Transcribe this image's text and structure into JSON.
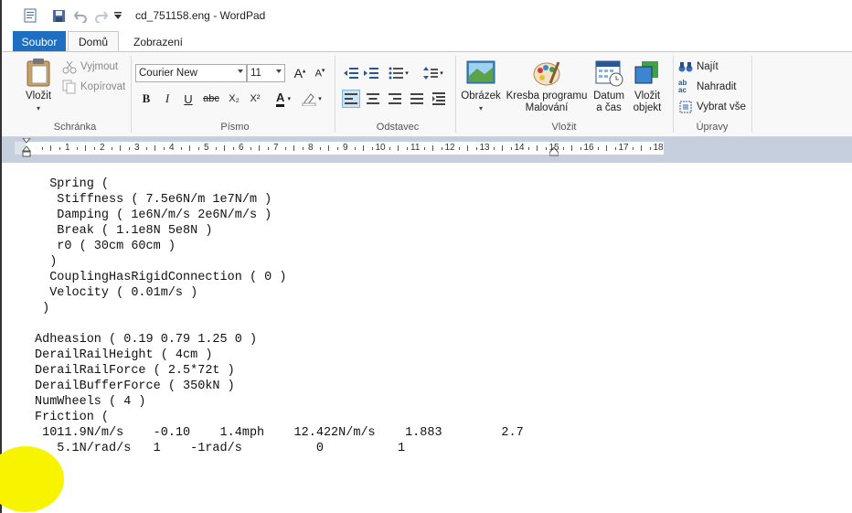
{
  "window": {
    "title": "cd_751158.eng - WordPad"
  },
  "quick_access": [
    "app-menu-icon",
    "save-icon",
    "undo-icon",
    "redo-icon",
    "customize-icon"
  ],
  "tabs": {
    "file": "Soubor",
    "home": "Domů",
    "view": "Zobrazení"
  },
  "ribbon": {
    "clipboard": {
      "label": "Schránka",
      "paste": "Vložit",
      "cut": "Vyjmout",
      "copy": "Kopírovat"
    },
    "font": {
      "label": "Písmo",
      "family": "Courier New",
      "size": "11",
      "bold": "B",
      "italic": "I",
      "underline": "U",
      "strike": "abc",
      "subscript": "X₂",
      "superscript": "X²"
    },
    "paragraph": {
      "label": "Odstavec"
    },
    "insert": {
      "label": "Vložit",
      "picture": "Obrázek",
      "paint_line1": "Kresba programu",
      "paint_line2": "Malování",
      "datetime_line1": "Datum",
      "datetime_line2": "a čas",
      "object_line1": "Vložit",
      "object_line2": "objekt"
    },
    "editing": {
      "label": "Úpravy",
      "find": "Najít",
      "replace": "Nahradit",
      "select_all": "Vybrat vše"
    }
  },
  "ruler": {
    "numbers": [
      "1",
      "2",
      "3",
      "4",
      "5",
      "6",
      "7",
      "8",
      "9",
      "10",
      "11",
      "12",
      "13",
      "14",
      "15",
      "16",
      "17",
      "18"
    ]
  },
  "document": {
    "text": "  Spring (\n   Stiffness ( 7.5e6N/m 1e7N/m )\n   Damping ( 1e6N/m/s 2e6N/m/s )\n   Break ( 1.1e8N 5e8N )\n   r0 ( 30cm 60cm )\n  )\n  CouplingHasRigidConnection ( 0 )\n  Velocity ( 0.01m/s )\n )\n\nAdheasion ( 0.19 0.79 1.25 0 )\nDerailRailHeight ( 4cm )\nDerailRailForce ( 2.5*72t )\nDerailBufferForce ( 350kN )\nNumWheels ( 4 )\nFriction (\n 1011.9N/m/s    -0.10    1.4mph    12.422N/m/s    1.883        2.7\n   5.1N/rad/s   1    -1rad/s          0          1",
    "closing": ")"
  },
  "colors": {
    "accent": "#1e6fc2",
    "ruler_bg": "#c5cfdd",
    "highlight": "#f8f400"
  }
}
